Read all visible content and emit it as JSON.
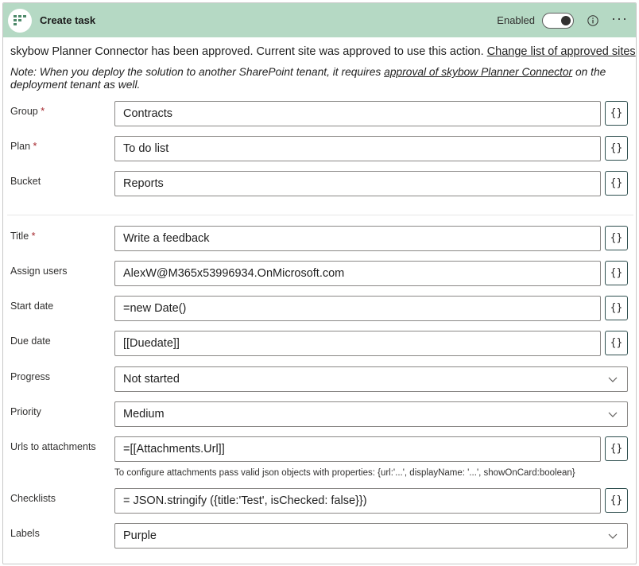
{
  "header": {
    "title": "Create task",
    "enabled_label": "Enabled",
    "toggle_on": true,
    "info_icon": "info-icon",
    "more_label": "···"
  },
  "approval": {
    "text": "skybow Planner Connector has been approved. Current site was approved to use this action.",
    "link": "Change list of approved sites"
  },
  "note": {
    "prefix": "Note: When you deploy the solution to another SharePoint tenant, it requires",
    "link": "approval of skybow Planner Connector",
    "suffix": "on the deployment tenant as well."
  },
  "required_mark": "*",
  "fx_label": "{}",
  "fields": {
    "group": {
      "label": "Group",
      "value": "Contracts"
    },
    "plan": {
      "label": "Plan",
      "value": "To do list"
    },
    "bucket": {
      "label": "Bucket",
      "value": "Reports"
    },
    "title": {
      "label": "Title",
      "value": "Write a feedback"
    },
    "assign_users": {
      "label": "Assign users",
      "value": "AlexW@M365x53996934.OnMicrosoft.com"
    },
    "start_date": {
      "label": "Start date",
      "value": "=new Date()"
    },
    "due_date": {
      "label": "Due date",
      "value": "[[Duedate]]"
    },
    "progress": {
      "label": "Progress",
      "value": "Not started"
    },
    "priority": {
      "label": "Priority",
      "value": "Medium"
    },
    "urls": {
      "label": "Urls to attachments",
      "value": "=[[Attachments.Url]]",
      "hint": "To configure attachments pass valid json objects with properties: {url:'...', displayName: '...', showOnCard:boolean}"
    },
    "checklists": {
      "label": "Checklists",
      "value": "= JSON.stringify ({title:'Test', isChecked: false}})"
    },
    "labels": {
      "label": "Labels",
      "value": "Purple"
    }
  },
  "colors": {
    "header_bg": "#b5d9c4",
    "required": "#a4262c",
    "input_border": "#8a8886",
    "fx_border": "#2f4f4f"
  }
}
